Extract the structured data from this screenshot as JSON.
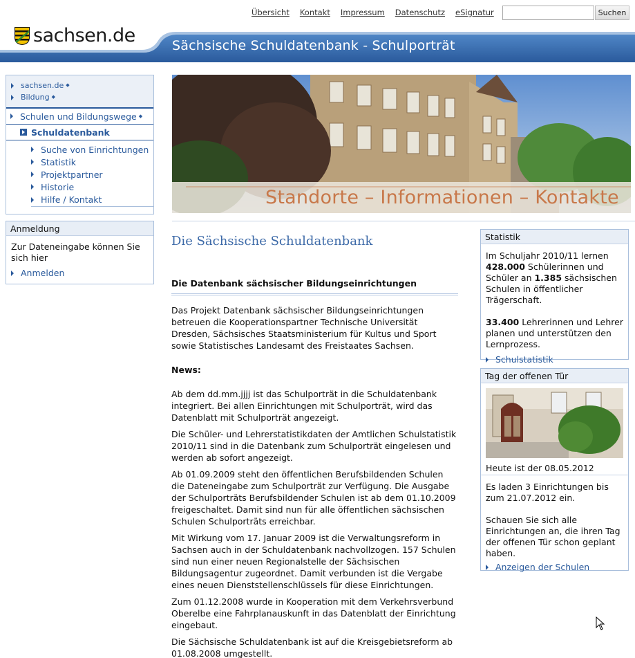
{
  "topnav": [
    "Übersicht",
    "Kontakt",
    "Impressum",
    "Datenschutz",
    "eSignatur"
  ],
  "search": {
    "placeholder": "",
    "button": "Suchen"
  },
  "logo": {
    "text": "sachsen.de"
  },
  "header": {
    "title": "Sächsische Schuldatenbank - Schulporträt"
  },
  "breadcrumb": [
    "sachsen.de",
    "Bildung"
  ],
  "leftnav": {
    "section": "Schulen und Bildungswege",
    "current": "Schuldatenbank",
    "items": [
      "Suche von Einrichtungen",
      "Statistik",
      "Projektpartner",
      "Historie",
      "Hilfe / Kontakt"
    ]
  },
  "login": {
    "title": "Anmeldung",
    "text": "Zur Dateneingabe können Sie sich hier",
    "link": "Anmelden"
  },
  "banner": {
    "text": "Standorte – Informationen – Kontakte"
  },
  "main": {
    "title": "Die Sächsische Schuldatenbank",
    "subtitle": "Die Datenbank sächsischer Bildungseinrichtungen",
    "intro": "Das Projekt Datenbank sächsischer Bildungseinrichtungen betreuen die Kooperationspartner Technische Universität Dresden, Sächsisches Staatsministerium für Kultus und Sport sowie Statistisches Landesamt des Freistaates Sachsen.",
    "news_label": "News:",
    "news": [
      "Ab dem dd.mm.jjjj ist das Schulporträt in die Schuldatenbank integriert. Bei allen Einrichtungen mit Schulporträt, wird das Datenblatt mit Schulporträt angezeigt.",
      "Die Schüler- und Lehrerstatistikdaten der Amtlichen Schulstatistik 2010/11 sind in die Datenbank zum Schulporträt eingelesen und werden ab sofort angezeigt.",
      "Ab 01.09.2009 steht den öffentlichen Berufsbildenden Schulen die Dateneingabe zum Schulporträt zur Verfügung. Die Ausgabe der Schulporträts Berufsbildender Schulen ist ab dem 01.10.2009 freigeschaltet. Damit sind nun für alle öffentlichen sächsischen Schulen Schulporträts erreichbar.",
      "Mit Wirkung vom 17. Januar 2009 ist die Verwaltungsreform in Sachsen auch in der Schuldatenbank nachvollzogen. 157 Schulen sind nun einer neuen Regionalstelle der Sächsischen Bildungsagentur zugeordnet. Damit verbunden ist die Vergabe eines neuen Dienststellenschlüssels für diese Einrichtungen.",
      "Zum 01.12.2008 wurde in Kooperation mit dem Verkehrsverbund Oberelbe eine Fahrplanauskunft in das Datenblatt der Einrichtung eingebaut.",
      "Die Sächsische Schuldatenbank ist auf die Kreisgebietsreform ab 01.08.2008 umgestellt."
    ]
  },
  "stats": {
    "title": "Statistik",
    "t1": "Im Schuljahr 2010/11 lernen",
    "n1": "428.000",
    "t2": " Schülerinnen und Schüler an ",
    "n2": "1.385",
    "t3": " sächsischen Schulen in öffentlicher Trägerschaft.",
    "n3": "33.400",
    "t4": " Lehrerinnen und Lehrer planen und unterstützen den Lernprozess.",
    "link": "Schulstatistik"
  },
  "opendoor": {
    "title": "Tag der offenen Tür",
    "date": "Heute ist der 08.05.2012",
    "text1": "Es laden 3 Einrichtungen bis zum 21.07.2012 ein.",
    "text2": "Schauen Sie sich alle Einrichtungen an, die ihren Tag der offenen Tür schon geplant haben.",
    "link": "Anzeigen der Schulen"
  },
  "colors": {
    "brand_blue": "#2a5a9c",
    "link": "#2a5a9c",
    "box_border": "#a9bfdc",
    "banner_text": "#c8784a"
  }
}
